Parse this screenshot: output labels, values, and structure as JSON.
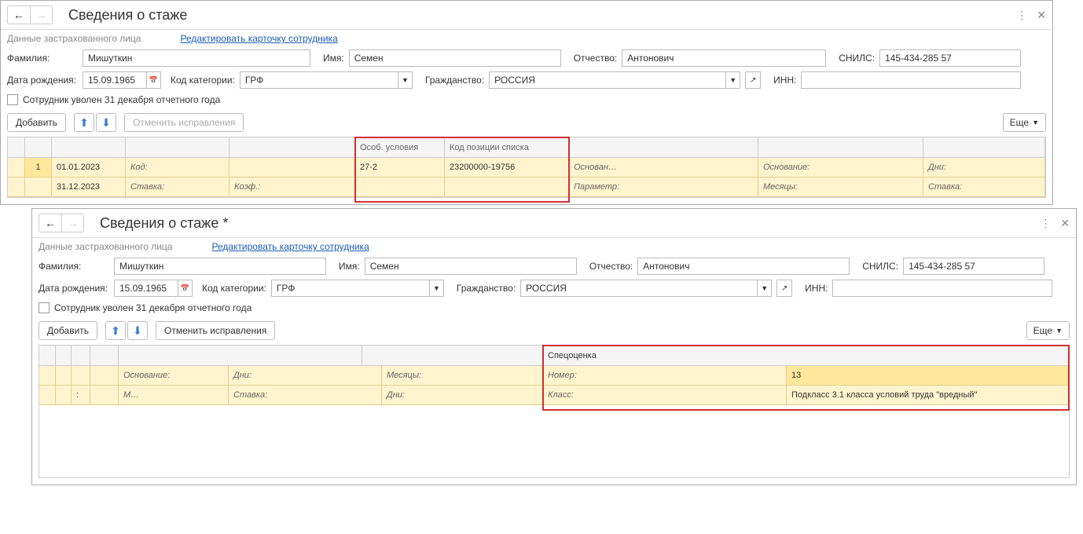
{
  "win1": {
    "title": "Сведения о стаже",
    "sub_gray": "Данные застрахованного лица",
    "edit_link": "Редактировать карточку сотрудника",
    "labels": {
      "surname": "Фамилия:",
      "name": "Имя:",
      "patronymic": "Отчество:",
      "snils": "СНИЛС:",
      "birthdate": "Дата рождения:",
      "category": "Код категории:",
      "citizenship": "Гражданство:",
      "inn": "ИНН:",
      "fired": "Сотрудник уволен 31 декабря отчетного года"
    },
    "values": {
      "surname": "Мишуткин",
      "name": "Семен",
      "patronymic": "Антонович",
      "snils": "145-434-285 57",
      "birthdate": "15.09.1965",
      "category": "ГРФ",
      "citizenship": "РОССИЯ",
      "inn": ""
    },
    "toolbar": {
      "add": "Добавить",
      "cancel": "Отменить исправления",
      "more": "Еще"
    },
    "headers": {
      "osob": "Особ. условия",
      "kod_poz": "Код позиции списка"
    },
    "row1": {
      "num": "1",
      "date_from": "01.01.2023",
      "kod_label": "Код:",
      "osob_val": "27-2",
      "kod_poz_val": "23200000-19756",
      "osnov1": "Основан…",
      "osnov2": "Основание:",
      "dni": "Дни:"
    },
    "row2": {
      "date_to": "31.12.2023",
      "stavka_label": "Ставка:",
      "koef_label": "Коэф.:",
      "param": "Параметр:",
      "mes": "Месяцы:",
      "stavka2": "Ставка:"
    }
  },
  "win2": {
    "title": "Сведения о стаже *",
    "sub_gray": "Данные застрахованного лица",
    "edit_link": "Редактировать карточку сотрудника",
    "labels": {
      "surname": "Фамилия:",
      "name": "Имя:",
      "patronymic": "Отчество:",
      "snils": "СНИЛС:",
      "birthdate": "Дата рождения:",
      "category": "Код категории:",
      "citizenship": "Гражданство:",
      "inn": "ИНН:",
      "fired": "Сотрудник уволен 31 декабря отчетного года"
    },
    "values": {
      "surname": "Мишуткин",
      "name": "Семен",
      "patronymic": "Антонович",
      "snils": "145-434-285 57",
      "birthdate": "15.09.1965",
      "category": "ГРФ",
      "citizenship": "РОССИЯ",
      "inn": ""
    },
    "toolbar": {
      "add": "Добавить",
      "cancel": "Отменить исправления",
      "more": "Еще"
    },
    "headers": {
      "spec": "Спецоценка"
    },
    "row1": {
      "osnov": "Основание:",
      "dni": "Дни:",
      "mes": "Месяцы:",
      "nomer": "Номер:",
      "nomer_val": "13"
    },
    "row2": {
      "m": "М…",
      "stavka": "Ставка:",
      "dni": "Дни:",
      "klass": "Класс:",
      "klass_val": "Подкласс 3.1 класса условий труда \"вредный\""
    }
  }
}
